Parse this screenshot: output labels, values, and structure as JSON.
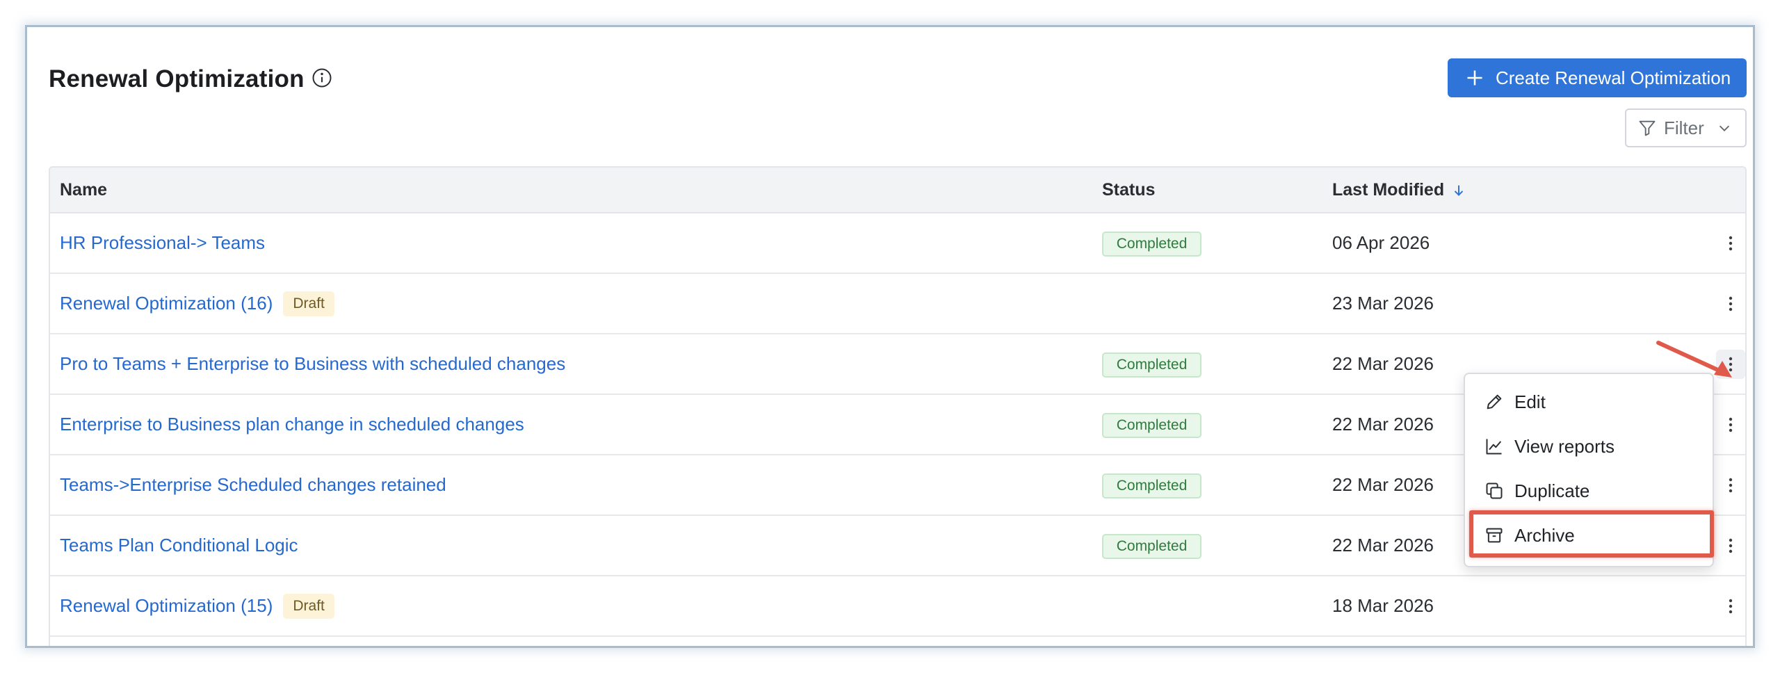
{
  "header": {
    "title": "Renewal Optimization",
    "create_button_label": "Create Renewal Optimization",
    "filter_label": "Filter"
  },
  "table": {
    "columns": {
      "name": "Name",
      "status": "Status",
      "last_modified": "Last Modified"
    },
    "sort": {
      "column": "Last Modified",
      "direction": "descending"
    },
    "rows": [
      {
        "name": "HR Professional-> Teams",
        "draft": "",
        "status": "Completed",
        "date": "06 Apr 2026"
      },
      {
        "name": "Renewal Optimization (16)",
        "draft": "Draft",
        "status": "",
        "date": "23 Mar 2026"
      },
      {
        "name": "Pro to Teams + Enterprise to Business with scheduled changes",
        "draft": "",
        "status": "Completed",
        "date": "22 Mar 2026"
      },
      {
        "name": "Enterprise to Business plan change in scheduled changes",
        "draft": "",
        "status": "Completed",
        "date": "22 Mar 2026"
      },
      {
        "name": "Teams->Enterprise Scheduled changes retained",
        "draft": "",
        "status": "Completed",
        "date": "22 Mar 2026"
      },
      {
        "name": "Teams Plan Conditional Logic",
        "draft": "",
        "status": "Completed",
        "date": "22 Mar 2026"
      },
      {
        "name": "Renewal Optimization (15)",
        "draft": "Draft",
        "status": "",
        "date": "18 Mar 2026"
      }
    ]
  },
  "context_menu": {
    "items": [
      {
        "label": "Edit",
        "icon": "pencil-icon"
      },
      {
        "label": "View reports",
        "icon": "line-chart-icon"
      },
      {
        "label": "Duplicate",
        "icon": "copy-icon"
      },
      {
        "label": "Archive",
        "icon": "archive-icon"
      }
    ],
    "highlighted": "Archive"
  },
  "colors": {
    "primary": "#2f74d8",
    "link": "#2569cf",
    "completed_bg": "#e8f7ea",
    "completed_text": "#2f7a3d",
    "draft_bg": "#fdf3d9",
    "annotation": "#e05a4c"
  }
}
